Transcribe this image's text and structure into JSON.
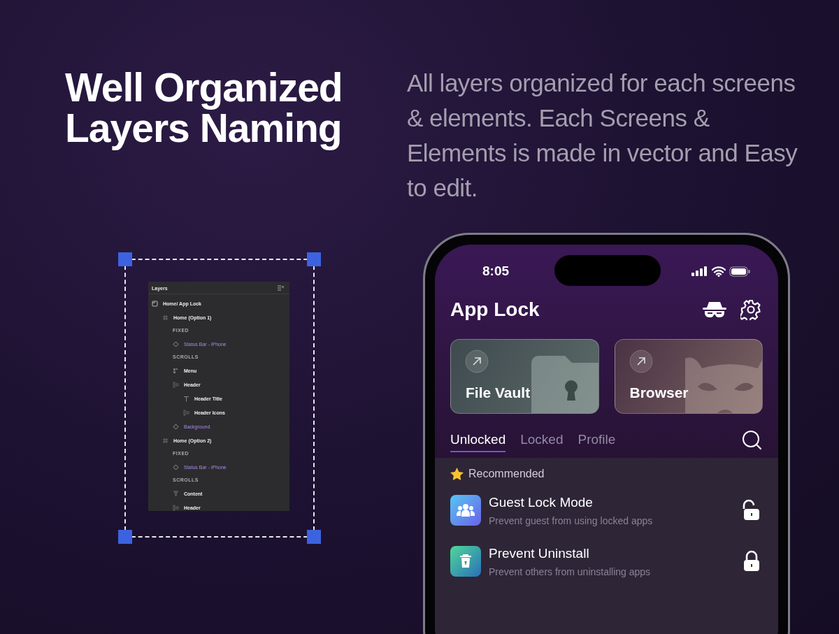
{
  "headline": "Well Organized Layers Naming",
  "description": "All layers organized for each screens & elements. Each Screens & Elements is made in vector and Easy to edit.",
  "layers_panel": {
    "title": "Layers",
    "tree": [
      {
        "kind": "page",
        "label": "Home/ App Lock",
        "children": [
          {
            "kind": "frame",
            "label": "Home (Option 1)",
            "children": [
              {
                "kind": "section",
                "label": "FIXED"
              },
              {
                "kind": "component",
                "label": "Status Bar - iPhone"
              },
              {
                "kind": "section",
                "label": "SCROLLS"
              },
              {
                "kind": "grid",
                "label": "Menu"
              },
              {
                "kind": "autolayout",
                "label": "Header",
                "children": [
                  {
                    "kind": "text",
                    "label": "Header Title"
                  },
                  {
                    "kind": "autolayout",
                    "label": "Header Icons"
                  }
                ]
              },
              {
                "kind": "component",
                "label": "Background"
              }
            ]
          },
          {
            "kind": "frame",
            "label": "Home (Option 2)",
            "children": [
              {
                "kind": "section",
                "label": "FIXED"
              },
              {
                "kind": "component",
                "label": "Status Bar - iPhone"
              },
              {
                "kind": "section",
                "label": "SCROLLS"
              },
              {
                "kind": "stack",
                "label": "Content"
              },
              {
                "kind": "autolayout",
                "label": "Header"
              }
            ]
          }
        ]
      }
    ]
  },
  "phone": {
    "time": "8:05",
    "title": "App Lock",
    "cards": [
      {
        "kind": "vault",
        "label": "File Vault"
      },
      {
        "kind": "browser",
        "label": "Browser"
      }
    ],
    "tabs": [
      {
        "label": "Unlocked",
        "selected": true
      },
      {
        "label": "Locked",
        "selected": false
      },
      {
        "label": "Profile",
        "selected": false
      }
    ],
    "section_title": "Recommended",
    "rows": [
      {
        "kind": "guest",
        "title": "Guest Lock Mode",
        "subtitle": "Prevent guest from using locked apps",
        "locked": false
      },
      {
        "kind": "uninstall",
        "title": "Prevent Uninstall",
        "subtitle": "Prevent others from uninstalling apps",
        "locked": true
      }
    ]
  }
}
